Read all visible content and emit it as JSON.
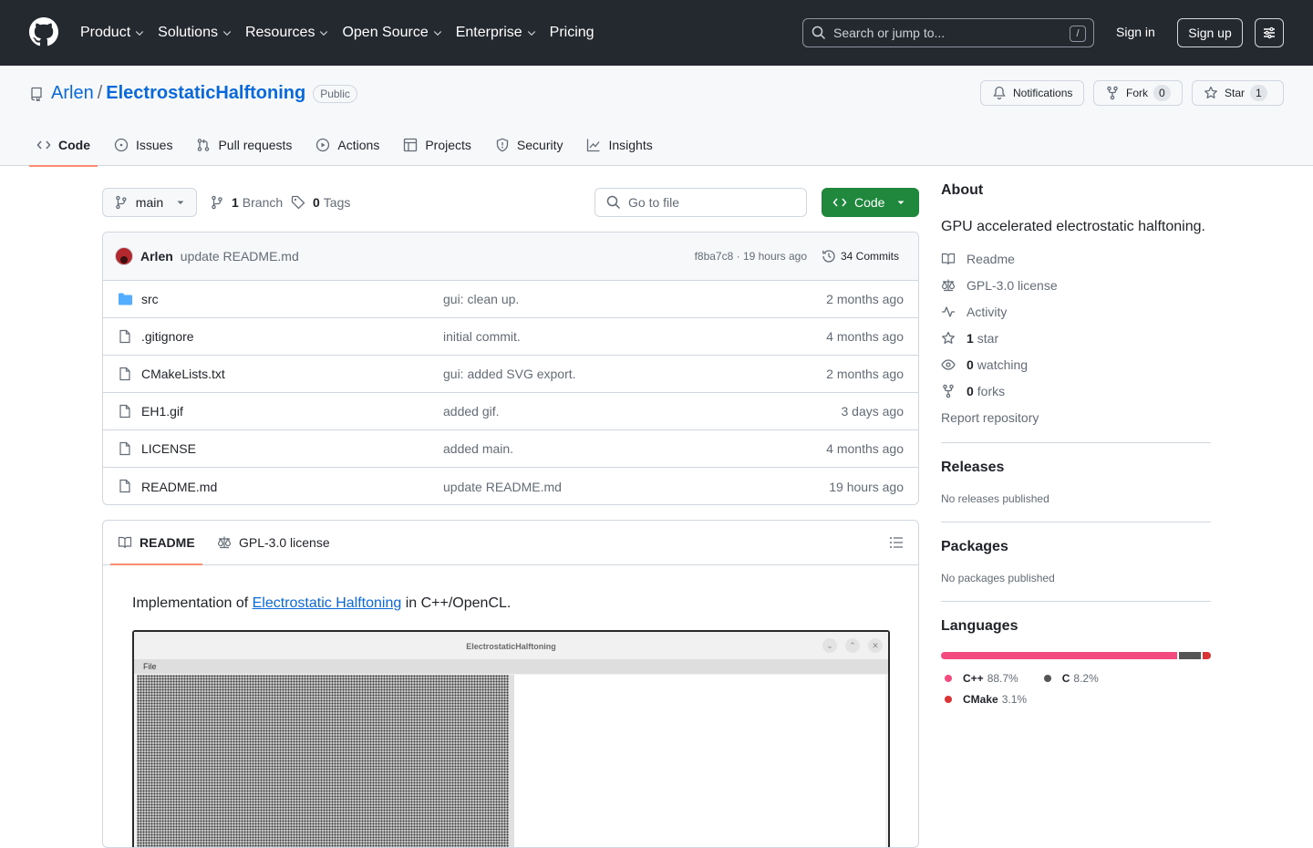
{
  "header": {
    "nav": [
      {
        "label": "Product",
        "dropdown": true
      },
      {
        "label": "Solutions",
        "dropdown": true
      },
      {
        "label": "Resources",
        "dropdown": true
      },
      {
        "label": "Open Source",
        "dropdown": true
      },
      {
        "label": "Enterprise",
        "dropdown": true
      },
      {
        "label": "Pricing",
        "dropdown": false
      }
    ],
    "search_placeholder": "Search or jump to...",
    "search_shortcut": "/",
    "sign_in": "Sign in",
    "sign_up": "Sign up"
  },
  "repo": {
    "owner": "Arlen",
    "separator": "/",
    "name": "ElectrostaticHalftoning",
    "visibility": "Public",
    "notifications_label": "Notifications",
    "fork_label": "Fork",
    "fork_count": "0",
    "star_label": "Star",
    "star_count": "1"
  },
  "tabs": [
    {
      "label": "Code",
      "icon": "code-icon",
      "active": true
    },
    {
      "label": "Issues",
      "icon": "issue-icon"
    },
    {
      "label": "Pull requests",
      "icon": "pull-request-icon"
    },
    {
      "label": "Actions",
      "icon": "play-icon"
    },
    {
      "label": "Projects",
      "icon": "table-icon"
    },
    {
      "label": "Security",
      "icon": "shield-icon"
    },
    {
      "label": "Insights",
      "icon": "graph-icon"
    }
  ],
  "filenav": {
    "branch": "main",
    "branch_count": "1",
    "branch_label": "Branch",
    "tag_count": "0",
    "tag_label": "Tags",
    "goto_placeholder": "Go to file",
    "code_button": "Code"
  },
  "commit": {
    "author": "Arlen",
    "message": "update README.md",
    "hash_time": "f8ba7c8 · 19 hours ago",
    "commits_label": "34 Commits"
  },
  "files": [
    {
      "name": "src",
      "type": "folder",
      "message": "gui: clean up.",
      "date": "2 months ago"
    },
    {
      "name": ".gitignore",
      "type": "file",
      "message": "initial commit.",
      "date": "4 months ago"
    },
    {
      "name": "CMakeLists.txt",
      "type": "file",
      "message": "gui: added SVG export.",
      "date": "2 months ago"
    },
    {
      "name": "EH1.gif",
      "type": "file",
      "message": "added gif.",
      "date": "3 days ago"
    },
    {
      "name": "LICENSE",
      "type": "file",
      "message": "added main.",
      "date": "4 months ago"
    },
    {
      "name": "README.md",
      "type": "file",
      "message": "update README.md",
      "date": "19 hours ago"
    }
  ],
  "readme": {
    "tab_readme": "README",
    "tab_license": "GPL-3.0 license",
    "intro_prefix": "Implementation of ",
    "intro_link": "Electrostatic Halftoning",
    "intro_suffix": " in C++/OpenCL.",
    "screenshot": {
      "window_title": "ElectrostaticHalftoning",
      "menu_file": "File"
    }
  },
  "sidebar": {
    "about_title": "About",
    "description": "GPU accelerated electrostatic halftoning.",
    "readme_link": "Readme",
    "license_link": "GPL-3.0 license",
    "activity_link": "Activity",
    "stars_count": "1",
    "stars_label": "star",
    "watching_count": "0",
    "watching_label": "watching",
    "forks_count": "0",
    "forks_label": "forks",
    "report_link": "Report repository",
    "releases_title": "Releases",
    "releases_empty": "No releases published",
    "packages_title": "Packages",
    "packages_empty": "No packages published",
    "languages_title": "Languages",
    "languages": [
      {
        "name": "C++",
        "percent": "88.7%",
        "share": 88.7,
        "color": "#f34b7d"
      },
      {
        "name": "C",
        "percent": "8.2%",
        "share": 8.2,
        "color": "#555555"
      },
      {
        "name": "CMake",
        "percent": "3.1%",
        "share": 3.1,
        "color": "#da3434"
      }
    ]
  }
}
